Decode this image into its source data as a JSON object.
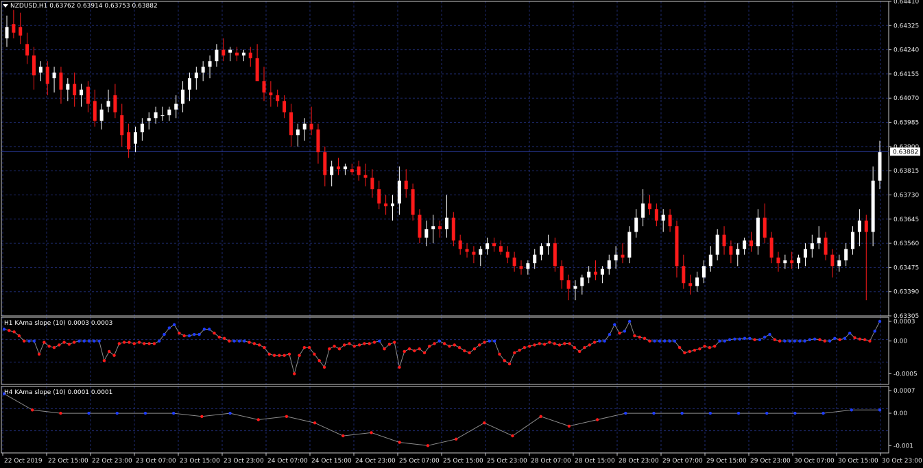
{
  "symbol_header": "NZDUSD,H1  0.63762 0.63914 0.63753 0.63882",
  "current_price_label": "0.63882",
  "colors": {
    "background": "#000000",
    "grid": "#1e2a6e",
    "frame": "#c8c8c8",
    "bull_candle": "#ffffff",
    "bear_candle": "#ff1a1a",
    "text": "#e6e6e6",
    "indicator_line": "#8c8c8c",
    "slope_up_dot": "#1e3cff",
    "slope_down_dot": "#ff1a1a",
    "price_line": "#2a3a9a"
  },
  "main_panel": {
    "y_ticks": [
      "0.64410",
      "0.64325",
      "0.64240",
      "0.64155",
      "0.64070",
      "0.63985",
      "0.63900",
      "0.63815",
      "0.63730",
      "0.63645",
      "0.63560",
      "0.63475",
      "0.63390",
      "0.63305"
    ]
  },
  "h1_panel": {
    "title": "H1 KAma slope (10) 0.0003 0.0003",
    "y_ticks": [
      "0.0003",
      "0.00",
      "-0.0005"
    ]
  },
  "h4_panel": {
    "title": "H4 KAma slope (10) 0.0001 0.0001",
    "y_ticks": [
      "0.0007",
      "0.00",
      "-0.001"
    ]
  },
  "x_ticks": [
    "22 Oct 2019",
    "22 Oct 15:00",
    "22 Oct 23:00",
    "23 Oct 07:00",
    "23 Oct 15:00",
    "23 Oct 23:00",
    "24 Oct 07:00",
    "24 Oct 15:00",
    "24 Oct 23:00",
    "25 Oct 07:00",
    "25 Oct 15:00",
    "25 Oct 23:00",
    "28 Oct 07:00",
    "28 Oct 15:00",
    "28 Oct 23:00",
    "29 Oct 07:00",
    "29 Oct 15:00",
    "29 Oct 23:00",
    "30 Oct 07:00",
    "30 Oct 15:00",
    "30 Oct 23:00"
  ],
  "chart_data": [
    {
      "type": "candlestick",
      "title": "NZDUSD,H1",
      "ylim": [
        0.63305,
        0.6441
      ],
      "grid": true,
      "last_price": 0.63882,
      "ohlc": [
        [
          0.6428,
          0.6436,
          0.6425,
          0.6432
        ],
        [
          0.6433,
          0.6438,
          0.6428,
          0.643
        ],
        [
          0.6432,
          0.6437,
          0.6426,
          0.6429
        ],
        [
          0.6426,
          0.643,
          0.6419,
          0.6422
        ],
        [
          0.6422,
          0.6425,
          0.641,
          0.6415
        ],
        [
          0.6416,
          0.642,
          0.6413,
          0.6418
        ],
        [
          0.6418,
          0.642,
          0.6408,
          0.6412
        ],
        [
          0.6414,
          0.6418,
          0.6409,
          0.6416
        ],
        [
          0.6416,
          0.6418,
          0.6405,
          0.641
        ],
        [
          0.641,
          0.6414,
          0.6406,
          0.6412
        ],
        [
          0.6412,
          0.6416,
          0.6404,
          0.6408
        ],
        [
          0.6408,
          0.6412,
          0.6404,
          0.641
        ],
        [
          0.6411,
          0.6413,
          0.6402,
          0.6405
        ],
        [
          0.6406,
          0.641,
          0.6397,
          0.6399
        ],
        [
          0.6399,
          0.6405,
          0.6396,
          0.6403
        ],
        [
          0.6404,
          0.641,
          0.6402,
          0.6406
        ],
        [
          0.6408,
          0.6412,
          0.64,
          0.6402
        ],
        [
          0.6401,
          0.6405,
          0.639,
          0.6394
        ],
        [
          0.6395,
          0.6398,
          0.6386,
          0.6389
        ],
        [
          0.6391,
          0.6397,
          0.6388,
          0.6395
        ],
        [
          0.6395,
          0.64,
          0.6392,
          0.6398
        ],
        [
          0.6399,
          0.6402,
          0.6396,
          0.64
        ],
        [
          0.64,
          0.6404,
          0.6398,
          0.6402
        ],
        [
          0.6401,
          0.6404,
          0.6399,
          0.6401
        ],
        [
          0.6401,
          0.6404,
          0.6399,
          0.6403
        ],
        [
          0.6403,
          0.6408,
          0.64,
          0.6405
        ],
        [
          0.6405,
          0.6413,
          0.6402,
          0.641
        ],
        [
          0.641,
          0.6416,
          0.6406,
          0.6414
        ],
        [
          0.6414,
          0.6418,
          0.641,
          0.6416
        ],
        [
          0.6416,
          0.642,
          0.6413,
          0.6418
        ],
        [
          0.6418,
          0.6422,
          0.6414,
          0.642
        ],
        [
          0.642,
          0.6426,
          0.6418,
          0.6424
        ],
        [
          0.6424,
          0.6428,
          0.642,
          0.6422
        ],
        [
          0.6423,
          0.6425,
          0.642,
          0.6424
        ],
        [
          0.6423,
          0.6425,
          0.642,
          0.6422
        ],
        [
          0.6422,
          0.6424,
          0.642,
          0.6423
        ],
        [
          0.6423,
          0.6425,
          0.6418,
          0.6421
        ],
        [
          0.6421,
          0.6426,
          0.6416,
          0.6413
        ],
        [
          0.6413,
          0.6418,
          0.6406,
          0.6409
        ],
        [
          0.6409,
          0.6413,
          0.6404,
          0.6408
        ],
        [
          0.6408,
          0.641,
          0.6404,
          0.6406
        ],
        [
          0.6406,
          0.6408,
          0.64,
          0.6402
        ],
        [
          0.6402,
          0.6405,
          0.639,
          0.6394
        ],
        [
          0.6394,
          0.6398,
          0.639,
          0.6396
        ],
        [
          0.6396,
          0.64,
          0.6392,
          0.6398
        ],
        [
          0.6398,
          0.6404,
          0.6394,
          0.6396
        ],
        [
          0.6396,
          0.6398,
          0.6384,
          0.6388
        ],
        [
          0.6388,
          0.639,
          0.6376,
          0.638
        ],
        [
          0.638,
          0.6385,
          0.6376,
          0.6383
        ],
        [
          0.6383,
          0.6386,
          0.638,
          0.6382
        ],
        [
          0.6382,
          0.6384,
          0.638,
          0.6383
        ],
        [
          0.6382,
          0.6384,
          0.638,
          0.6381
        ],
        [
          0.6383,
          0.6385,
          0.6378,
          0.638
        ],
        [
          0.638,
          0.6384,
          0.6376,
          0.6379
        ],
        [
          0.6379,
          0.6382,
          0.6372,
          0.6375
        ],
        [
          0.6375,
          0.6378,
          0.6368,
          0.637
        ],
        [
          0.637,
          0.6373,
          0.6366,
          0.6369
        ],
        [
          0.6369,
          0.6373,
          0.6364,
          0.637
        ],
        [
          0.637,
          0.6383,
          0.6366,
          0.6378
        ],
        [
          0.6378,
          0.6382,
          0.6372,
          0.6375
        ],
        [
          0.6375,
          0.6377,
          0.6364,
          0.6366
        ],
        [
          0.6366,
          0.6368,
          0.6356,
          0.6358
        ],
        [
          0.6358,
          0.6364,
          0.6355,
          0.6361
        ],
        [
          0.6361,
          0.6366,
          0.6356,
          0.6362
        ],
        [
          0.6362,
          0.6364,
          0.6358,
          0.6361
        ],
        [
          0.6361,
          0.6373,
          0.6358,
          0.6365
        ],
        [
          0.6365,
          0.6367,
          0.6355,
          0.6357
        ],
        [
          0.6357,
          0.6359,
          0.6352,
          0.6354
        ],
        [
          0.6354,
          0.6356,
          0.6351,
          0.6353
        ],
        [
          0.6353,
          0.6355,
          0.6349,
          0.6352
        ],
        [
          0.6352,
          0.6355,
          0.6348,
          0.6354
        ],
        [
          0.6354,
          0.6358,
          0.6352,
          0.6356
        ],
        [
          0.6356,
          0.6358,
          0.6353,
          0.6355
        ],
        [
          0.6355,
          0.6357,
          0.6352,
          0.6353
        ],
        [
          0.6353,
          0.6355,
          0.6349,
          0.6351
        ],
        [
          0.6351,
          0.6353,
          0.6346,
          0.6348
        ],
        [
          0.6348,
          0.635,
          0.6345,
          0.6347
        ],
        [
          0.6347,
          0.635,
          0.6345,
          0.6349
        ],
        [
          0.6349,
          0.6354,
          0.6347,
          0.6352
        ],
        [
          0.6352,
          0.6356,
          0.635,
          0.6355
        ],
        [
          0.6355,
          0.6359,
          0.6352,
          0.6356
        ],
        [
          0.6356,
          0.6358,
          0.6346,
          0.6348
        ],
        [
          0.6348,
          0.635,
          0.634,
          0.6343
        ],
        [
          0.6343,
          0.6345,
          0.6336,
          0.634
        ],
        [
          0.634,
          0.6343,
          0.6336,
          0.6341
        ],
        [
          0.6341,
          0.6345,
          0.6338,
          0.6344
        ],
        [
          0.6344,
          0.6348,
          0.6342,
          0.6346
        ],
        [
          0.6346,
          0.635,
          0.6343,
          0.6345
        ],
        [
          0.6345,
          0.6348,
          0.6342,
          0.6347
        ],
        [
          0.6347,
          0.6352,
          0.6345,
          0.635
        ],
        [
          0.635,
          0.6355,
          0.6347,
          0.6352
        ],
        [
          0.6352,
          0.6356,
          0.6349,
          0.6351
        ],
        [
          0.6351,
          0.6362,
          0.6349,
          0.636
        ],
        [
          0.636,
          0.6368,
          0.6358,
          0.6365
        ],
        [
          0.6365,
          0.6375,
          0.6362,
          0.637
        ],
        [
          0.637,
          0.6373,
          0.6366,
          0.6368
        ],
        [
          0.6368,
          0.637,
          0.6362,
          0.6364
        ],
        [
          0.6364,
          0.6368,
          0.636,
          0.6366
        ],
        [
          0.6366,
          0.6368,
          0.636,
          0.6362
        ],
        [
          0.6362,
          0.6364,
          0.6344,
          0.6348
        ],
        [
          0.6348,
          0.6352,
          0.634,
          0.6342
        ],
        [
          0.6342,
          0.6345,
          0.6338,
          0.6341
        ],
        [
          0.6341,
          0.6346,
          0.6339,
          0.6344
        ],
        [
          0.6344,
          0.635,
          0.6342,
          0.6348
        ],
        [
          0.6348,
          0.6355,
          0.6346,
          0.6352
        ],
        [
          0.6352,
          0.6361,
          0.635,
          0.6359
        ],
        [
          0.6359,
          0.6362,
          0.6352,
          0.6355
        ],
        [
          0.6355,
          0.6357,
          0.6349,
          0.6352
        ],
        [
          0.6352,
          0.6356,
          0.6348,
          0.6354
        ],
        [
          0.6354,
          0.6358,
          0.6352,
          0.6357
        ],
        [
          0.6357,
          0.636,
          0.6353,
          0.6355
        ],
        [
          0.6355,
          0.6368,
          0.6352,
          0.6365
        ],
        [
          0.6365,
          0.637,
          0.6356,
          0.6358
        ],
        [
          0.6358,
          0.636,
          0.6349,
          0.6351
        ],
        [
          0.6351,
          0.6353,
          0.6346,
          0.6349
        ],
        [
          0.6349,
          0.6352,
          0.6347,
          0.635
        ],
        [
          0.635,
          0.6353,
          0.6347,
          0.6349
        ],
        [
          0.6349,
          0.6352,
          0.6347,
          0.6351
        ],
        [
          0.6351,
          0.6356,
          0.6348,
          0.6354
        ],
        [
          0.6354,
          0.6359,
          0.6351,
          0.6356
        ],
        [
          0.6356,
          0.6362,
          0.6354,
          0.6358
        ],
        [
          0.6358,
          0.636,
          0.635,
          0.6352
        ],
        [
          0.6352,
          0.6354,
          0.6344,
          0.6348
        ],
        [
          0.6348,
          0.6352,
          0.6346,
          0.635
        ],
        [
          0.635,
          0.6356,
          0.6348,
          0.6354
        ],
        [
          0.6354,
          0.6362,
          0.6352,
          0.636
        ],
        [
          0.636,
          0.6368,
          0.6355,
          0.6364
        ],
        [
          0.6364,
          0.6366,
          0.6336,
          0.636
        ],
        [
          0.636,
          0.6383,
          0.6355,
          0.6378
        ],
        [
          0.6378,
          0.6392,
          0.6375,
          0.6388
        ]
      ]
    },
    {
      "type": "line",
      "title": "H1 KAma slope (10)",
      "ylim": [
        -0.0006,
        0.0003
      ],
      "values": [
        0.00018,
        0.00016,
        0.00014,
        8e-05,
        0.0,
        0.0,
        0.0,
        -0.0002,
        -2e-05,
        -8e-05,
        -0.0001,
        -6e-05,
        -2e-05,
        -5e-05,
        -2e-05,
        -0.0,
        -0.0,
        -0.0,
        -0.0,
        -0.0,
        -0.0003,
        -0.00016,
        -0.00022,
        -4e-05,
        -2e-05,
        -2e-05,
        -4e-05,
        -2e-05,
        -4e-05,
        -4e-05,
        -4e-05,
        0.0,
        0.0001,
        0.0002,
        0.00025,
        0.00012,
        8e-05,
        8e-05,
        0.0001,
        0.0001,
        0.00018,
        0.00018,
        0.00012,
        6e-05,
        4e-05,
        0.0,
        0.0,
        0.0,
        -0.0,
        -2e-05,
        -4e-05,
        -6e-05,
        -0.0001,
        -0.0002,
        -0.00022,
        -0.00022,
        -0.00022,
        -0.0002,
        -0.0005,
        -0.00022,
        -0.0001,
        -0.0001,
        -0.0002,
        -0.0003,
        -0.0004,
        -0.00012,
        -8e-05,
        -0.00012,
        -6e-05,
        -4e-05,
        -8e-05,
        -6e-05,
        -4e-05,
        -4e-05,
        -2e-05,
        -0.0,
        -0.00012,
        -5e-05,
        -2e-05,
        -0.0004,
        -0.00016,
        -0.00012,
        -0.00015,
        -0.00012,
        -0.00018,
        -8e-05,
        -4e-05,
        0.0,
        -4e-05,
        -8e-05,
        -6e-05,
        -0.0001,
        -0.00015,
        -0.00018,
        -0.00012,
        -6e-05,
        -2e-05,
        -0.0,
        -0.0,
        -0.0002,
        -0.0003,
        -0.00035,
        -0.00018,
        -0.00014,
        -0.0001,
        -8e-05,
        -6e-05,
        -4e-05,
        -5e-05,
        -2e-05,
        -4e-05,
        -6e-05,
        -4e-05,
        -4e-05,
        -0.0001,
        -0.00016,
        -0.0001,
        -6e-05,
        -2e-05,
        -0.0,
        0.0,
        0.0001,
        0.00025,
        0.00012,
        0.00015,
        0.0003,
        8e-05,
        6e-05,
        4e-05,
        0.0,
        0.0,
        0.0,
        -0.0,
        -0.0,
        -0.0,
        -0.0001,
        -0.00018,
        -0.00016,
        -0.00014,
        -0.00012,
        -8e-05,
        -0.0001,
        -8e-05,
        0.0,
        -0.0,
        2e-05,
        3e-05,
        3e-05,
        4e-05,
        4e-05,
        2e-05,
        2e-05,
        6e-05,
        0.0001,
        2e-05,
        0.0,
        0.0,
        0.0,
        0.0,
        0.0,
        0.0,
        2e-05,
        3e-05,
        2e-05,
        0.0,
        0.0,
        4e-05,
        2e-05,
        4e-05,
        0.00012,
        5e-05,
        3e-05,
        2e-05,
        0.0,
        0.00015,
        0.0003
      ]
    },
    {
      "type": "line",
      "title": "H4 KAma slope (10)",
      "ylim": [
        -0.0011,
        0.0007
      ],
      "values": [
        0.0006,
        0.0001,
        0.0,
        0.0,
        0.0,
        0.0,
        0.0,
        -0.0001,
        0.0,
        -0.0002,
        -0.0001,
        -0.0003,
        -0.0007,
        -0.0006,
        -0.0009,
        -0.001,
        -0.0008,
        -0.0003,
        -0.0007,
        -0.0001,
        -0.0004,
        -0.0002,
        0.0,
        0.0,
        0.0,
        0.0,
        0.0,
        0.0,
        0.0,
        0.0,
        0.0001,
        0.0001
      ]
    }
  ]
}
